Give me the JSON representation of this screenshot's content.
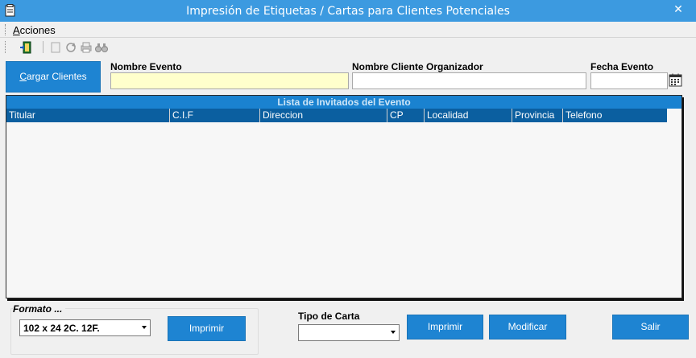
{
  "window": {
    "title": "Impresión de Etiquetas / Cartas para Clientes Potenciales",
    "close_glyph": "✕"
  },
  "menu": {
    "acciones_prefix": "A",
    "acciones_rest": "cciones"
  },
  "toolbar": {
    "icons": [
      "exit-door-icon",
      "new-document-icon",
      "refresh-icon",
      "print-icon",
      "binoculars-icon"
    ]
  },
  "buttons": {
    "cargar_prefix": "C",
    "cargar_rest": "argar Clientes",
    "imprimir_formato": "Imprimir",
    "imprimir_carta": "Imprimir",
    "modificar": "Modificar",
    "salir": "Salir"
  },
  "fields": {
    "nombre_evento": {
      "label": "Nombre Evento",
      "value": ""
    },
    "nombre_cliente": {
      "label": "Nombre Cliente Organizador",
      "value": ""
    },
    "fecha_evento": {
      "label": "Fecha Evento",
      "value": ""
    }
  },
  "grid": {
    "caption": "Lista de Invitados del Evento",
    "columns": [
      "Titular",
      "C.I.F",
      "Direccion",
      "CP",
      "Localidad",
      "Provincia",
      "Telefono"
    ],
    "rows": []
  },
  "formato": {
    "label": "Formato ...",
    "selected": "102 x 24  2C. 12F."
  },
  "tipo_carta": {
    "label": "Tipo de Carta",
    "selected": ""
  },
  "colors": {
    "titlebar": "#3c9ae0",
    "button": "#1e84d2",
    "grid_header": "#0b5fa0",
    "grid_caption": "#1a82d0",
    "required_field": "#ffffcc"
  }
}
